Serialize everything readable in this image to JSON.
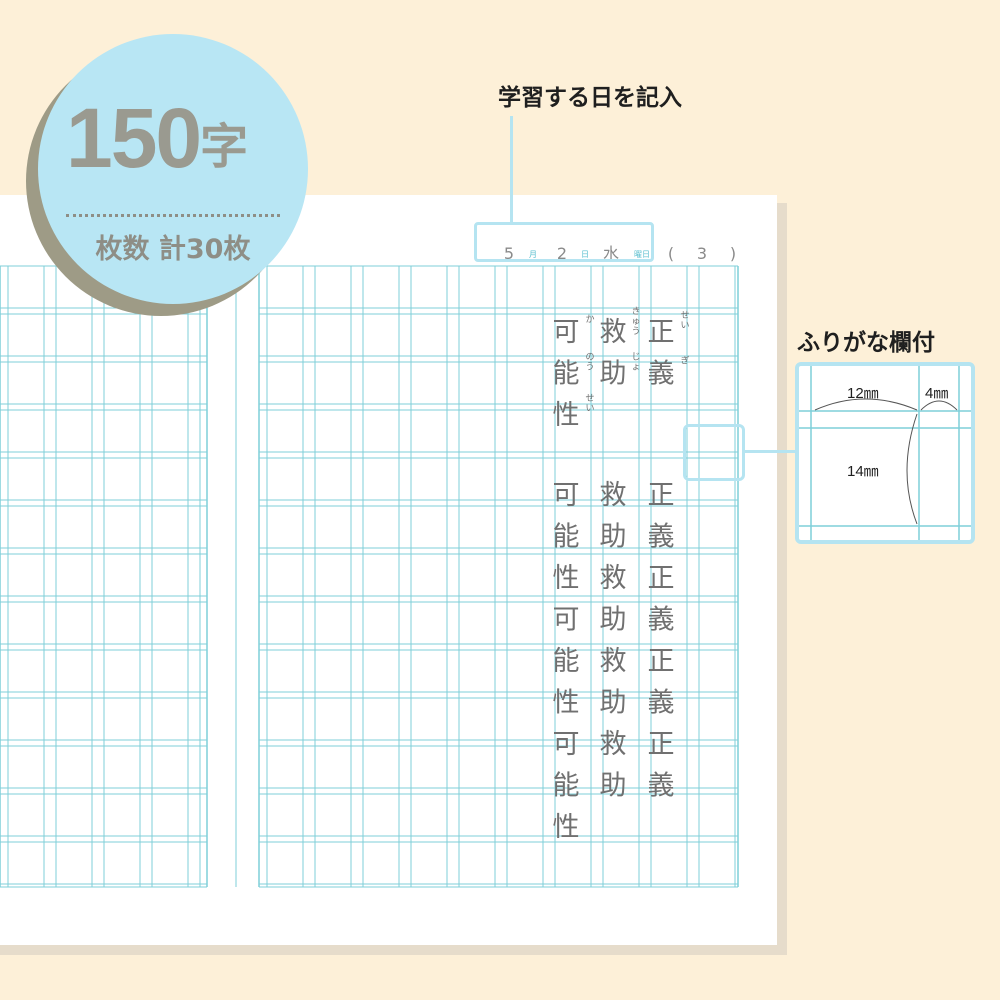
{
  "badge": {
    "count": "150",
    "count_unit": "字",
    "subtitle": "枚数 計30枚"
  },
  "callouts": {
    "date_entry": "学習する日を記入",
    "furigana_column": "ふりがな欄付"
  },
  "date_header": {
    "month": "5",
    "month_label": "月",
    "day": "2",
    "day_label": "日",
    "weekday": "水",
    "weekday_label": "曜日",
    "open_paren": "(",
    "number": "3",
    "close_paren": ")"
  },
  "sample_upper": [
    {
      "chars": [
        "可",
        "能",
        "性"
      ],
      "furigana": [
        "か",
        "のう",
        "せい"
      ]
    },
    {
      "chars": [
        "救",
        "助"
      ],
      "furigana": [
        "きゅう",
        "じょ"
      ]
    },
    {
      "chars": [
        "正",
        "義"
      ],
      "furigana": [
        "せい",
        "ぎ"
      ]
    }
  ],
  "sample_lower": [
    [
      "可",
      "能",
      "性",
      "可",
      "能",
      "性",
      "可",
      "能",
      "性"
    ],
    [
      "救",
      "助",
      "救",
      "助",
      "救",
      "助",
      "救",
      "助"
    ],
    [
      "正",
      "義",
      "正",
      "義",
      "正",
      "義",
      "正",
      "義"
    ]
  ],
  "dimensions": {
    "main_width": "12㎜",
    "furigana_width": "4㎜",
    "cell_height": "14㎜"
  },
  "colors": {
    "background": "#fdf0d8",
    "grid_line": "#7fcfd9",
    "accent_light_blue": "#b5e4f1",
    "badge_fill": "#b8e6f4",
    "badge_shadow": "#9e9b86",
    "handwriting": "#707070"
  }
}
